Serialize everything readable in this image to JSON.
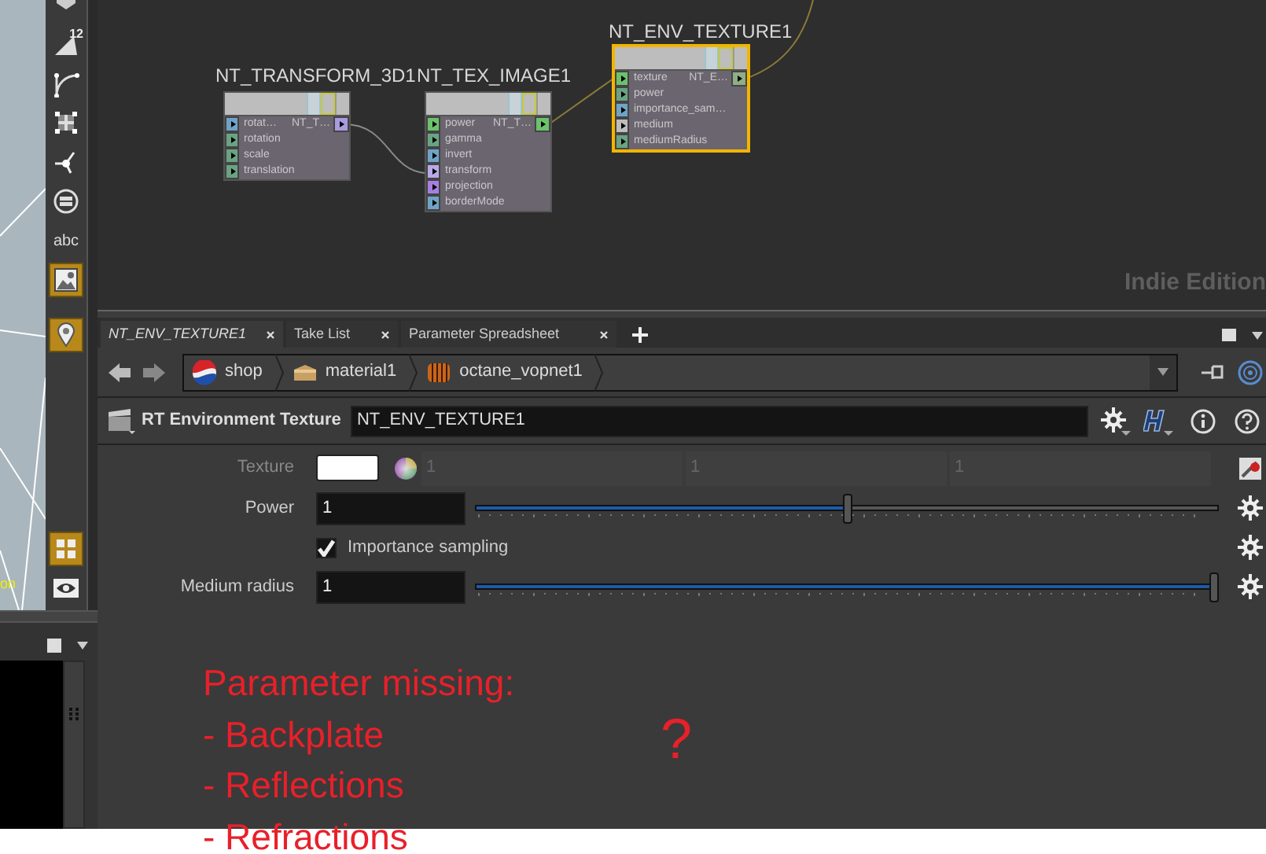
{
  "viewport": {
    "label": "on"
  },
  "toolbar": {
    "items": [
      {
        "kind": "cube",
        "selected": false
      },
      {
        "kind": "ruler",
        "label": "12",
        "selected": false
      },
      {
        "kind": "curve",
        "selected": false
      },
      {
        "kind": "transform",
        "selected": false
      },
      {
        "kind": "pivot",
        "selected": false
      },
      {
        "kind": "null",
        "selected": false
      },
      {
        "kind": "text",
        "label": "abc",
        "selected": false
      },
      {
        "kind": "image",
        "selected": true
      },
      {
        "kind": "pin",
        "selected": true
      },
      {
        "kind": "grid",
        "selected": true
      },
      {
        "kind": "eye",
        "selected": false
      }
    ]
  },
  "network": {
    "watermark": "Indie Edition",
    "nodes": [
      {
        "title": "NT_TRANSFORM_3D1",
        "selected": false,
        "output": {
          "label": "NT_T…",
          "color": "#a99be0"
        },
        "ports": [
          {
            "label": "rotat…",
            "color": "#6fa3c7"
          },
          {
            "label": "rotation",
            "color": "#6aa383"
          },
          {
            "label": "scale",
            "color": "#6aa383"
          },
          {
            "label": "translation",
            "color": "#6aa383"
          }
        ]
      },
      {
        "title": "NT_TEX_IMAGE1",
        "selected": false,
        "output": {
          "label": "NT_T…",
          "color": "#6cc26c"
        },
        "ports": [
          {
            "label": "power",
            "color": "#6cc26c"
          },
          {
            "label": "gamma",
            "color": "#6aa383"
          },
          {
            "label": "invert",
            "color": "#6fa3c7"
          },
          {
            "label": "transform",
            "color": "#b9a9e8"
          },
          {
            "label": "projection",
            "color": "#a77fe0"
          },
          {
            "label": "borderMode",
            "color": "#6fa3c7"
          }
        ]
      },
      {
        "title": "NT_ENV_TEXTURE1",
        "selected": true,
        "output": {
          "label": "NT_E…",
          "color": "#8fae85"
        },
        "ports": [
          {
            "label": "texture",
            "color": "#6cc26c"
          },
          {
            "label": "power",
            "color": "#6aa383"
          },
          {
            "label": "importance_sam…",
            "color": "#6fa3c7"
          },
          {
            "label": "medium",
            "color": "#bdbdbd"
          },
          {
            "label": "mediumRadius",
            "color": "#6aa383"
          }
        ]
      }
    ]
  },
  "pane_tabs": [
    {
      "label": "NT_ENV_TEXTURE1",
      "selected": true
    },
    {
      "label": "Take List",
      "selected": false
    },
    {
      "label": "Parameter Spreadsheet",
      "selected": false
    }
  ],
  "path": [
    {
      "kind": "shop",
      "label": "shop"
    },
    {
      "kind": "material",
      "label": "material1"
    },
    {
      "kind": "vopnet",
      "label": "octane_vopnet1"
    }
  ],
  "node": {
    "type": "RT Environment Texture",
    "name": "NT_ENV_TEXTURE1"
  },
  "parameters": [
    {
      "kind": "color",
      "label": "Texture",
      "disabled": true,
      "values": [
        "1",
        "1",
        "1"
      ]
    },
    {
      "kind": "slider",
      "label": "Power",
      "value": "1",
      "level": 0.5
    },
    {
      "kind": "toggle",
      "label": "Importance sampling",
      "checked": true
    },
    {
      "kind": "slider",
      "label": "Medium radius",
      "value": "1",
      "level": 1
    }
  ],
  "annotation": {
    "lines": [
      "Parameter missing:",
      "- Backplate",
      "- Reflections",
      "- Refractions"
    ],
    "mark": "?"
  }
}
